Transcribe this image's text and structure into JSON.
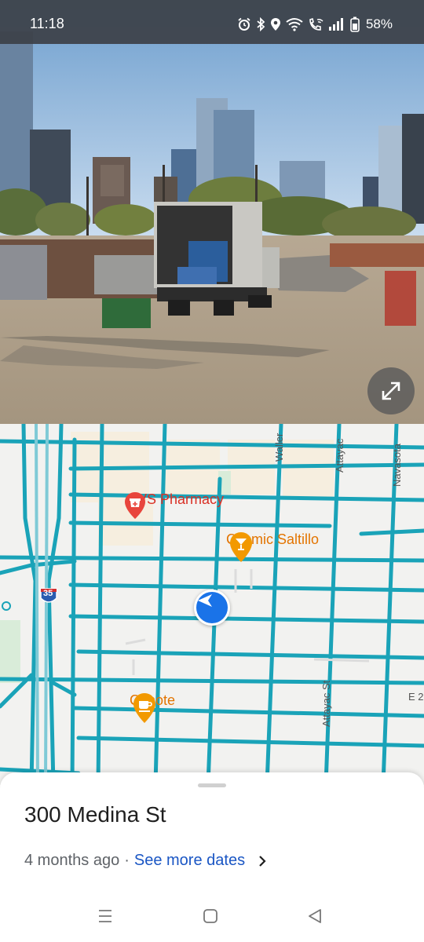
{
  "status_bar": {
    "time": "11:18",
    "battery_percent": "58%",
    "icons": [
      "alarm-icon",
      "bluetooth-icon",
      "location-icon",
      "wifi-icon",
      "wifi-calling-icon",
      "signal-icon",
      "battery-icon"
    ]
  },
  "street_view": {
    "expand_icon": "expand-icon"
  },
  "map": {
    "pois": [
      {
        "name": "CVS Pharmacy",
        "icon": "pharmacy-pin-icon",
        "color": "#d93025"
      },
      {
        "name": "Cosmic Saltillo",
        "icon": "bar-pin-icon",
        "color": "#e37400"
      },
      {
        "name": "Cenote",
        "icon": "cafe-pin-icon",
        "color": "#e37400"
      }
    ],
    "streets": [
      "Waller",
      "Attayac",
      "Navasota",
      "Attayac St",
      "E 2"
    ],
    "highway_shield": "35",
    "road_color": "#1aa3b8",
    "location_marker": "navigation-arrow-icon"
  },
  "sheet": {
    "title": "300 Medina St",
    "date": "4 months ago",
    "separator": "·",
    "see_more": "See more dates"
  },
  "nav_bar": {
    "buttons": [
      "recent-apps-icon",
      "home-icon",
      "back-icon"
    ]
  }
}
